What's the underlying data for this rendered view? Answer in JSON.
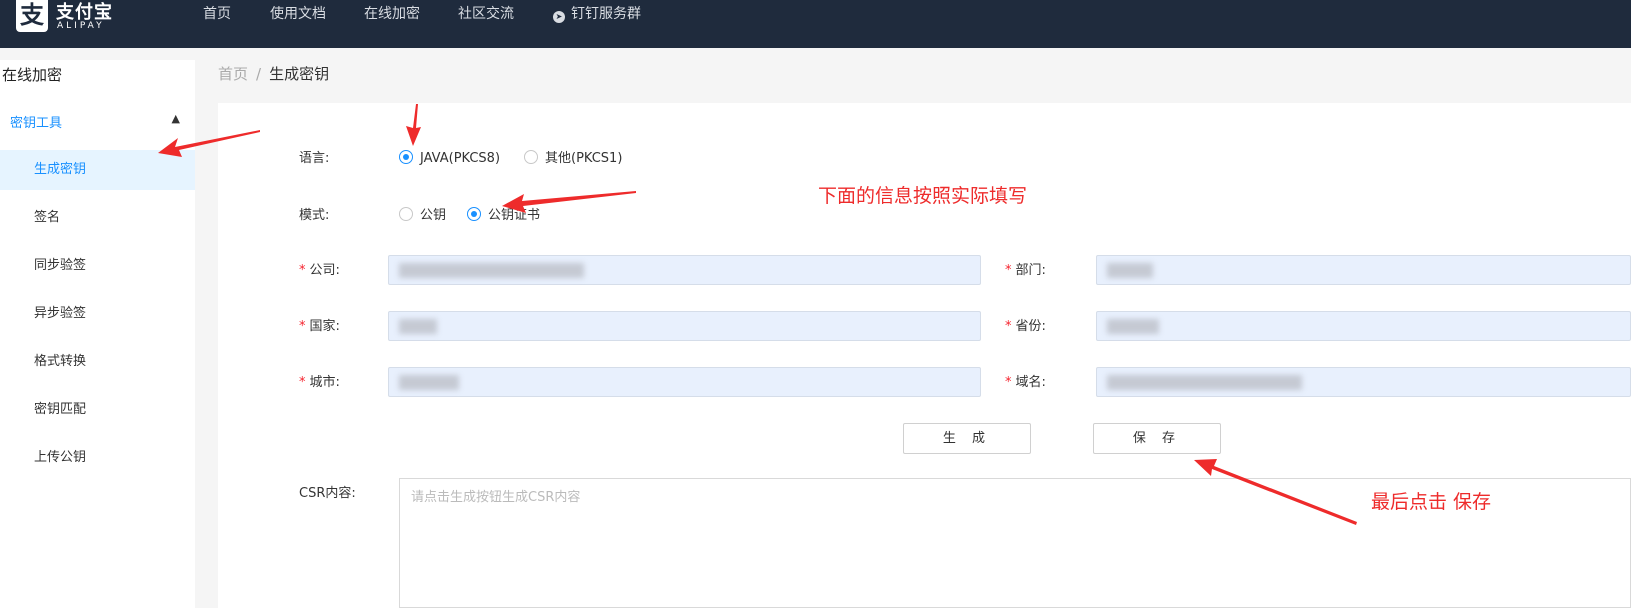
{
  "header": {
    "logo": {
      "cn": "支付宝",
      "en": "ALIPAY",
      "mark": "支",
      "icon": "alipay-logo-icon"
    },
    "nav": [
      {
        "label": "首页"
      },
      {
        "label": "使用文档"
      },
      {
        "label": "在线加密"
      },
      {
        "label": "社区交流"
      },
      {
        "label": "钉钉服务群",
        "icon": "dingtalk-icon"
      }
    ]
  },
  "sidebar": {
    "title": "在线加密",
    "group": {
      "label": "密钥工具",
      "icon": "chevron-up-icon",
      "expanded": true
    },
    "items": [
      {
        "label": "生成密钥",
        "active": true
      },
      {
        "label": "签名"
      },
      {
        "label": "同步验签"
      },
      {
        "label": "异步验签"
      },
      {
        "label": "格式转换"
      },
      {
        "label": "密钥匹配"
      },
      {
        "label": "上传公钥"
      }
    ]
  },
  "breadcrumb": {
    "home": "首页",
    "separator": "/",
    "current": "生成密钥"
  },
  "form": {
    "language": {
      "label": "语言:",
      "options": [
        "JAVA(PKCS8)",
        "其他(PKCS1)"
      ],
      "selected": "JAVA(PKCS8)"
    },
    "mode": {
      "label": "模式:",
      "options": [
        "公钥",
        "公钥证书"
      ],
      "selected": "公钥证书"
    },
    "company": {
      "label": "公司:",
      "required": true
    },
    "department": {
      "label": "部门:",
      "required": true
    },
    "country": {
      "label": "国家:",
      "required": true
    },
    "province": {
      "label": "省份:",
      "required": true
    },
    "city": {
      "label": "城市:",
      "required": true
    },
    "domain": {
      "label": "域名:",
      "required": true
    },
    "required_mark": "*",
    "generate_button": "生 成",
    "save_button": "保 存",
    "csr": {
      "label": "CSR内容:",
      "placeholder": "请点击生成按钮生成CSR内容"
    }
  },
  "annotations": {
    "fill_note": "下面的信息按照实际填写",
    "save_note": "最后点击 保存",
    "color": "#ee2b2b"
  },
  "colors": {
    "header_bg": "#1f2b3d",
    "accent": "#1890ff",
    "field_bg": "#e8f0fd"
  }
}
